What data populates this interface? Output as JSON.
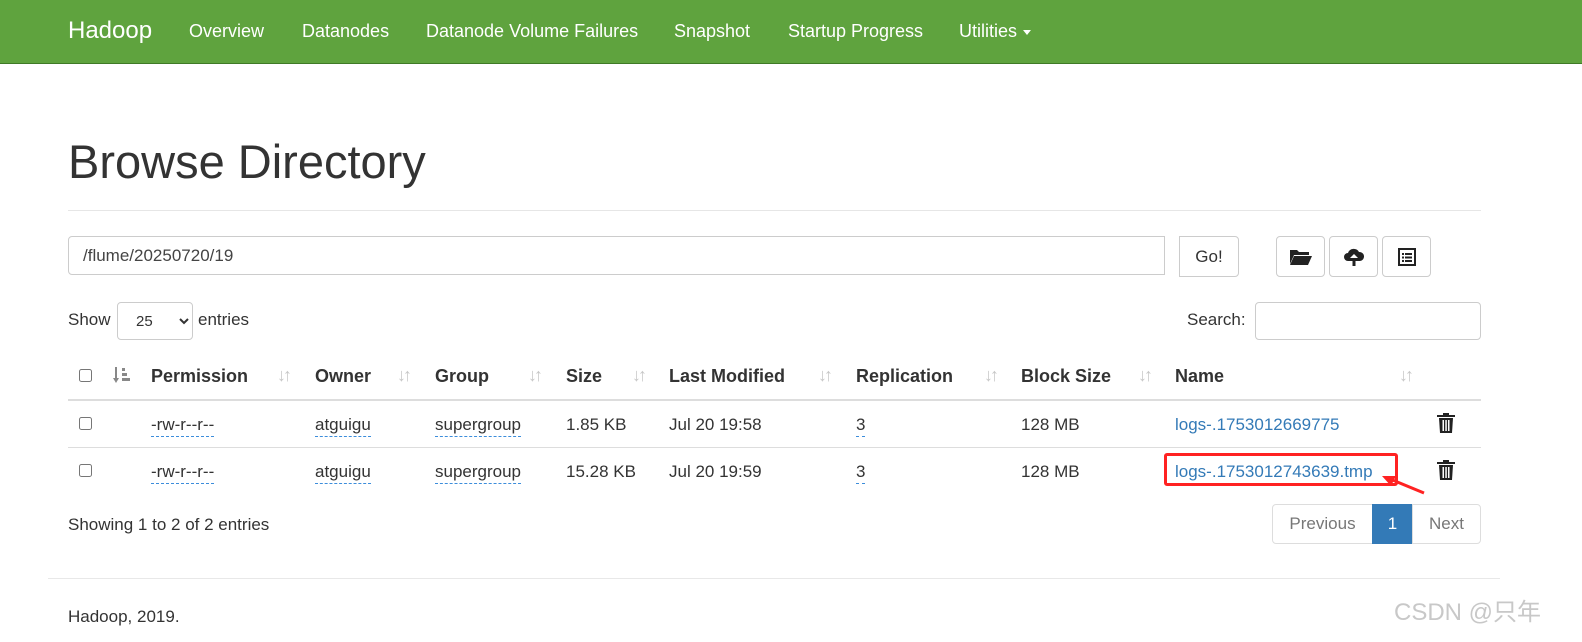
{
  "navbar": {
    "brand": "Hadoop",
    "items": [
      "Overview",
      "Datanodes",
      "Datanode Volume Failures",
      "Snapshot",
      "Startup Progress",
      "Utilities"
    ],
    "bg_color": "#5fa33e"
  },
  "page": {
    "title": "Browse Directory"
  },
  "path_bar": {
    "value": "/flume/20250720/19",
    "go_label": "Go!",
    "icons": [
      "folder-open-icon",
      "cloud-upload-icon",
      "list-alt-icon"
    ]
  },
  "table_controls": {
    "show_label": "Show",
    "entries_label": "entries",
    "page_length": "25",
    "search_label": "Search:",
    "search_value": ""
  },
  "table": {
    "columns": [
      "Permission",
      "Owner",
      "Group",
      "Size",
      "Last Modified",
      "Replication",
      "Block Size",
      "Name"
    ],
    "rows": [
      {
        "permission": "-rw-r--r--",
        "owner": "atguigu",
        "group": "supergroup",
        "size": "1.85 KB",
        "last_modified": "Jul 20 19:58",
        "replication": "3",
        "block_size": "128 MB",
        "name": "logs-.1753012669775"
      },
      {
        "permission": "-rw-r--r--",
        "owner": "atguigu",
        "group": "supergroup",
        "size": "15.28 KB",
        "last_modified": "Jul 20 19:59",
        "replication": "3",
        "block_size": "128 MB",
        "name": "logs-.1753012743639.tmp"
      }
    ]
  },
  "table_info": "Showing 1 to 2 of 2 entries",
  "pagination": {
    "previous": "Previous",
    "current": "1",
    "next": "Next",
    "active_color": "#337ab7"
  },
  "footer": "Hadoop, 2019.",
  "watermark": "CSDN @只年",
  "annotation_color": "#ff2222"
}
